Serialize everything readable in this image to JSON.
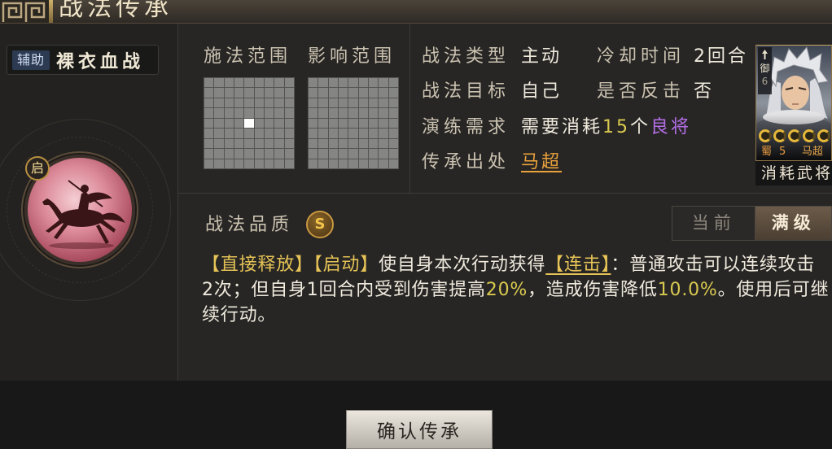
{
  "header": {
    "title": "战法传承"
  },
  "tactic": {
    "type_tag": "辅助",
    "name": "裸衣血战",
    "icon": "horse-rider-icon",
    "start_badge": "启"
  },
  "range": {
    "cast_label": "施法范围",
    "effect_label": "影响范围",
    "grid_rows": 9,
    "grid_cols": 9,
    "cast_cells": [
      [
        4,
        4
      ]
    ],
    "effect_cells": []
  },
  "info": {
    "type_label": "战法类型",
    "type_value": "主动",
    "cooldown_label": "冷却时间",
    "cooldown_value": "2回合",
    "target_label": "战法目标",
    "target_value": "自己",
    "counter_label": "是否反击",
    "counter_value": "否",
    "training_label": "演练需求",
    "training_prefix": "需要消耗",
    "training_count": "15",
    "training_unit": "个",
    "training_item": "良将",
    "source_label": "传承出处",
    "source_value": "马超"
  },
  "general_card": {
    "rank_icon": "spear-icon",
    "rank_label": "御",
    "rank_value": "6",
    "level_pips": 5,
    "faction": "蜀",
    "cost": "5",
    "name": "马超",
    "caption": "消耗武将"
  },
  "quality": {
    "label": "战法品质",
    "grade": "S"
  },
  "level_toggle": {
    "options": [
      "当前",
      "满级"
    ],
    "active_index": 1
  },
  "description": {
    "lines": [
      [
        {
          "text": "【直接释放】",
          "color": "#e6c356"
        },
        {
          "text": "【启动】",
          "color": "#e6c356"
        },
        {
          "text": "使自身本次行动获得"
        },
        {
          "text": "【连击】",
          "color": "#e6c356",
          "underline": true
        },
        {
          "text": "：普通攻击可以连续攻击"
        }
      ],
      [
        {
          "text": "2次；但自身1回合内受到伤害提高"
        },
        {
          "text": "20%",
          "color": "#d9c94f"
        },
        {
          "text": "，造成伤害降低"
        },
        {
          "text": "10.0%",
          "color": "#d9c94f"
        },
        {
          "text": "。使用后可继"
        }
      ],
      [
        {
          "text": "续行动。"
        }
      ]
    ]
  },
  "footer": {
    "confirm_label": "确认传承"
  },
  "colors": {
    "gold": "#e6c356",
    "number_gold": "#d9c94f",
    "purple": "#b46ee6",
    "orange": "#e9a23b",
    "text": "#f0eadd",
    "label": "#cbc2b0"
  }
}
